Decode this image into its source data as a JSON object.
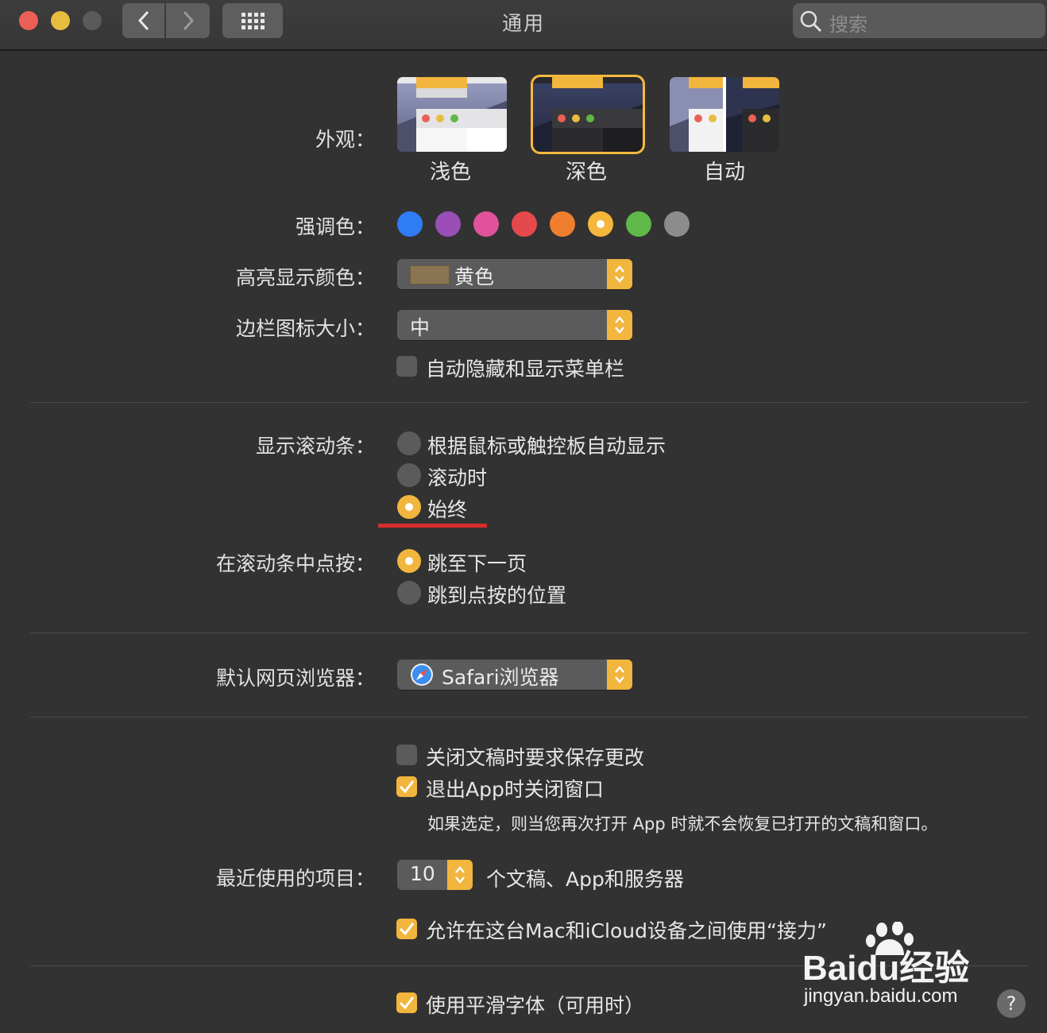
{
  "window": {
    "title": "通用",
    "search_placeholder": "搜索"
  },
  "appearance": {
    "label": "外观：",
    "options": [
      {
        "label": "浅色",
        "selected": false
      },
      {
        "label": "深色",
        "selected": true
      },
      {
        "label": "自动",
        "selected": false
      }
    ]
  },
  "accent": {
    "label": "强调色：",
    "colors": [
      "#2f7cf6",
      "#9a4fb8",
      "#e0529c",
      "#e5484d",
      "#ef7f2f",
      "#f5b63b",
      "#5fb848",
      "#8c8c8c"
    ],
    "selected_index": 5
  },
  "highlight": {
    "label": "高亮显示颜色：",
    "value": "黄色",
    "chip_color": "#8a7452"
  },
  "sidebar_icon": {
    "label": "边栏图标大小：",
    "value": "中"
  },
  "autohide_menubar": {
    "label": "自动隐藏和显示菜单栏",
    "checked": false
  },
  "scrollbars": {
    "label": "显示滚动条：",
    "options": [
      {
        "label": "根据鼠标或触控板自动显示",
        "selected": false
      },
      {
        "label": "滚动时",
        "selected": false
      },
      {
        "label": "始终",
        "selected": true
      }
    ]
  },
  "scroll_click": {
    "label": "在滚动条中点按：",
    "options": [
      {
        "label": "跳至下一页",
        "selected": true
      },
      {
        "label": "跳到点按的位置",
        "selected": false
      }
    ]
  },
  "browser": {
    "label": "默认网页浏览器：",
    "value": "Safari浏览器"
  },
  "ask_save": {
    "label": "关闭文稿时要求保存更改",
    "checked": false
  },
  "close_windows": {
    "label": "退出App时关闭窗口",
    "checked": true,
    "note": "如果选定，则当您再次打开 App 时就不会恢复已打开的文稿和窗口。"
  },
  "recent": {
    "label": "最近使用的项目：",
    "value": "10",
    "suffix": "个文稿、App和服务器"
  },
  "handoff": {
    "label": "允许在这台Mac和iCloud设备之间使用“接力”",
    "checked": true
  },
  "font_smoothing": {
    "label": "使用平滑字体（可用时）",
    "checked": true
  },
  "watermark": {
    "brand": "Baidu经验",
    "url": "jingyan.baidu.com"
  },
  "help": "?"
}
